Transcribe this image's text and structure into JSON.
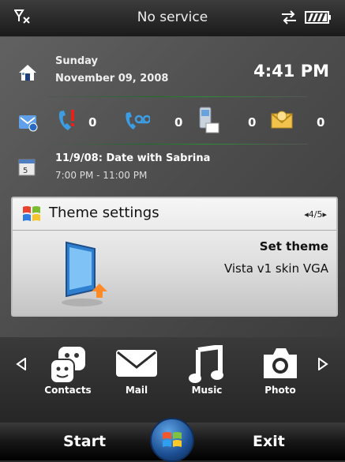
{
  "status": {
    "carrier_text": "No service"
  },
  "home": {
    "day": "Sunday",
    "date": "November 09, 2008",
    "time": "4:41 PM"
  },
  "notifications": {
    "missed_calls": "0",
    "voicemail": "0",
    "text_messages": "0",
    "email": "0"
  },
  "appointment": {
    "title": "11/9/08: Date with Sabrina",
    "time": "7:00 PM - 11:00 PM"
  },
  "card": {
    "title": "Theme settings",
    "pager": "◂4/5▸",
    "label": "Set theme",
    "value": "Vista v1 skin VGA"
  },
  "dock": {
    "apps": [
      {
        "label": "Contacts",
        "icon": "contacts-icon"
      },
      {
        "label": "Mail",
        "icon": "mail-icon"
      },
      {
        "label": "Music",
        "icon": "music-icon"
      },
      {
        "label": "Photo",
        "icon": "camera-icon"
      }
    ]
  },
  "softkeys": {
    "left": "Start",
    "right": "Exit"
  }
}
